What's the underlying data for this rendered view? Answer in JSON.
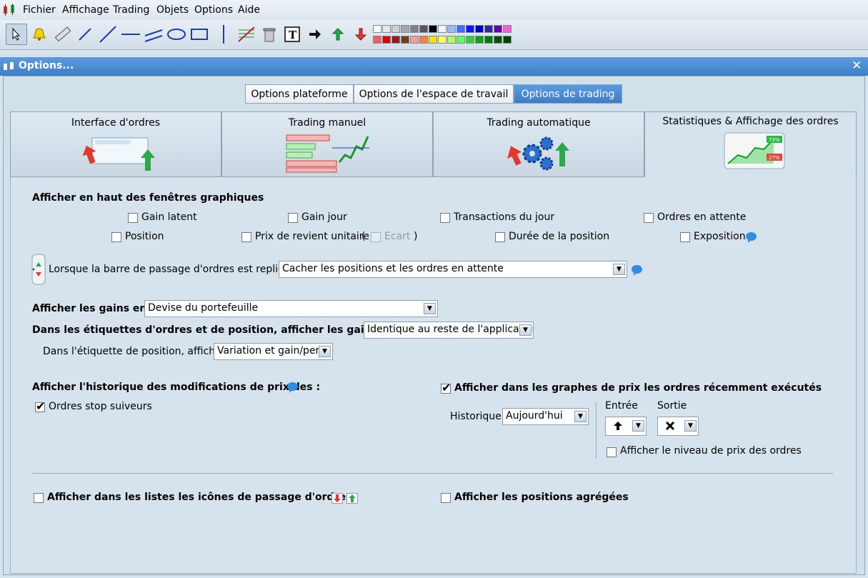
{
  "menubar": {
    "items": [
      "Fichier",
      "Affichage",
      "Trading",
      "Objets",
      "Options",
      "Aide"
    ]
  },
  "toolbar": {
    "tools": [
      "cursor-icon",
      "bell-icon",
      "ruler-icon",
      "segment-icon",
      "line-icon",
      "horizontal-line-icon",
      "channel-icon",
      "ellipse-icon",
      "rectangle-icon",
      "vertical-line-icon",
      "fibonacci-icon",
      "trash-icon",
      "text-icon",
      "arrow-right-icon",
      "arrow-up-icon",
      "arrow-down-icon"
    ],
    "colors_row1": [
      "#ffffff",
      "#e6e6e6",
      "#cfcfcf",
      "#a8a8a8",
      "#808080",
      "#575757",
      "#000000",
      "#f4f4ff",
      "#9ab8ff",
      "#3f6bff",
      "#1212ff",
      "#0000c0",
      "#2a2aa0",
      "#6a00a0",
      "#ff5bd0"
    ],
    "colors_row2": [
      "#ff5a5a",
      "#e00000",
      "#9a1a1a",
      "#704010",
      "#ff9a9a",
      "#ff7f3f",
      "#ffe000",
      "#ffff60",
      "#b6ff5f",
      "#60ff60",
      "#30d030",
      "#10a010",
      "#007a00",
      "#005000",
      "#004000"
    ]
  },
  "dialog": {
    "title": "Options...",
    "close": "✕"
  },
  "top_tabs": [
    "Options plateforme",
    "Options de l'espace de travail",
    "Options de trading"
  ],
  "big_tabs": [
    "Interface d'ordres",
    "Trading manuel",
    "Trading automatique",
    "Statistiques & Affichage des ordres"
  ],
  "section1": {
    "heading": "Afficher en haut des fenêtres graphiques",
    "gain_latent": "Gain latent",
    "gain_jour": "Gain jour",
    "transactions": "Transactions du jour",
    "ordres_attente": "Ordres en attente",
    "position": "Position",
    "prix_revient": "Prix de revient unitaire",
    "paren_open": "(",
    "ecart": "Ecart",
    "paren_close": ")",
    "duree": "Durée de la position",
    "exposition": "Exposition"
  },
  "section2": {
    "label": "Lorsque la barre de passage d'ordres est repliée :",
    "value": "Cacher les positions et les ordres en attente"
  },
  "section3": {
    "gains_label": "Afficher les gains en :",
    "gains_value": "Devise du portefeuille",
    "etiquettes_label": "Dans les étiquettes d'ordres et de position, afficher les gains en :",
    "etiquettes_value": "Identique au reste de l'application",
    "position_label": "Dans l'étiquette de position, afficher :",
    "position_value": "Variation et gain/perte"
  },
  "section4": {
    "historique_label": "Afficher l'historique des modifications de prix des :",
    "stop_label": "Ordres stop suiveurs",
    "graphes_label": "Afficher dans les graphes de prix les ordres récemment exécutés",
    "historique": "Historique",
    "historique_value": "Aujourd'hui",
    "entree": "Entrée",
    "sortie": "Sortie",
    "niveau_label": "Afficher le niveau de prix des ordres"
  },
  "section5": {
    "icones_label": "Afficher dans les listes les icônes de passage d'ordres",
    "agregees_label": "Afficher les positions agrégées"
  },
  "stat_badges": [
    "73%",
    "27%"
  ]
}
